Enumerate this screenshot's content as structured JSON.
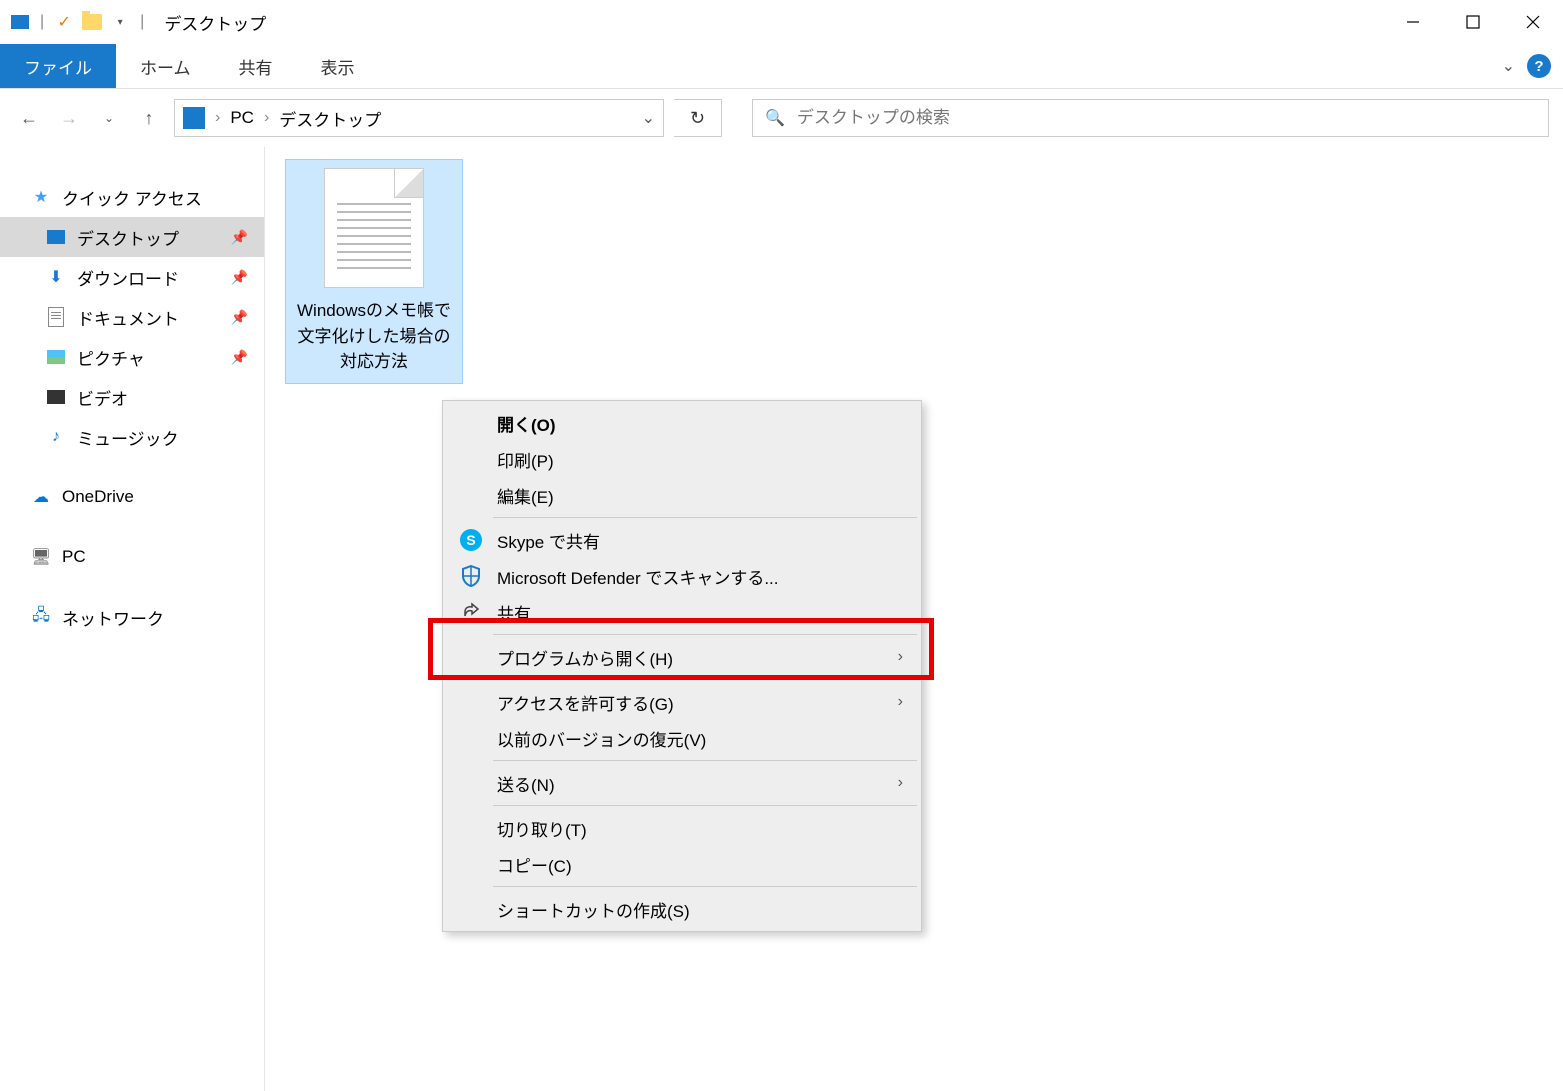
{
  "window": {
    "title": "デスクトップ"
  },
  "ribbon": {
    "tabs": {
      "file": "ファイル",
      "home": "ホーム",
      "share": "共有",
      "view": "表示"
    }
  },
  "address": {
    "root": "PC",
    "current": "デスクトップ"
  },
  "search": {
    "placeholder": "デスクトップの検索"
  },
  "sidebar": {
    "quick_access": "クイック アクセス",
    "desktop": "デスクトップ",
    "downloads": "ダウンロード",
    "documents": "ドキュメント",
    "pictures": "ピクチャ",
    "videos": "ビデオ",
    "music": "ミュージック",
    "onedrive": "OneDrive",
    "pc": "PC",
    "network": "ネットワーク"
  },
  "file": {
    "name": "Windowsのメモ帳で文字化けした場合の対応方法"
  },
  "context_menu": {
    "open": "開く(O)",
    "print": "印刷(P)",
    "edit": "編集(E)",
    "skype": "Skype で共有",
    "defender": "Microsoft Defender でスキャンする...",
    "share": "共有",
    "open_with": "プログラムから開く(H)",
    "grant_access": "アクセスを許可する(G)",
    "restore": "以前のバージョンの復元(V)",
    "send_to": "送る(N)",
    "cut": "切り取り(T)",
    "copy": "コピー(C)",
    "create_shortcut": "ショートカットの作成(S)"
  }
}
